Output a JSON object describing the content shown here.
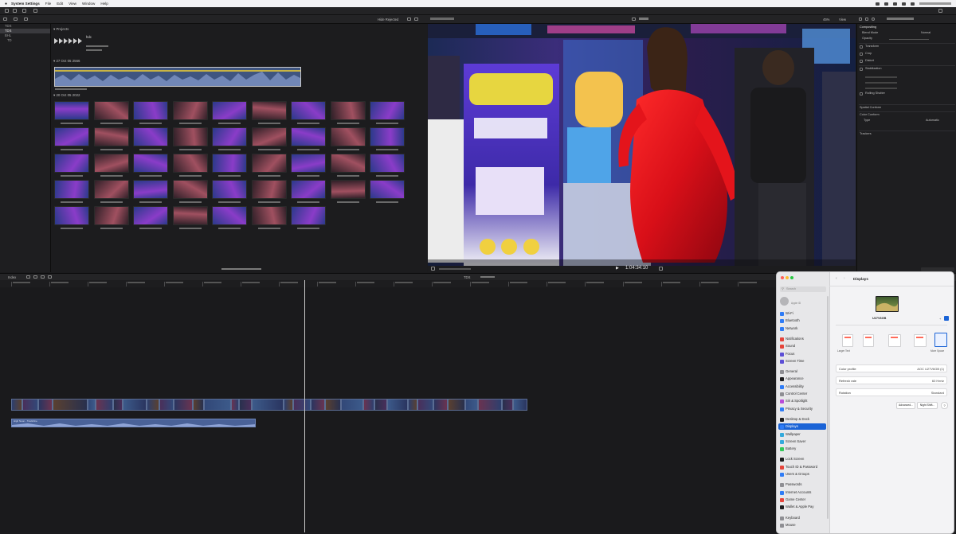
{
  "menubar": {
    "app": "System Settings",
    "items": [
      "File",
      "Edit",
      "View",
      "Window",
      "Help"
    ]
  },
  "toolbar": {
    "hide_rejected": "Hide Rejected",
    "zoom": "45%",
    "view": "View"
  },
  "libraries": {
    "items": [
      {
        "label": "TDS",
        "selected": false
      },
      {
        "label": "TDS",
        "selected": true
      },
      {
        "label": "BHL",
        "selected": false
      },
      {
        "label": "TD",
        "selected": false
      }
    ]
  },
  "browser": {
    "projects_header": "Projects",
    "project_name": "hdc",
    "section_27": "27 Oct 05 2566",
    "section_20": "20 Oct 05 2022",
    "footer": ""
  },
  "viewer": {
    "timecode": "1:04:34:10"
  },
  "inspector": {
    "sections": [
      "Compositing",
      "Transform",
      "Crop",
      "Distort",
      "Stabilization",
      "Rolling Shutter",
      "Spatial Conform",
      "Color Conform",
      "Trackers"
    ],
    "blend_mode_label": "Blend Mode",
    "blend_mode_value": "Normal",
    "opacity_label": "Opacity",
    "type_label": "Type",
    "type_value": "Automatic"
  },
  "timeline": {
    "index_label": "Index",
    "project_label": "TDS",
    "audio_label": "High Noon - TrackOne"
  },
  "settings": {
    "search_placeholder": "Search",
    "user_name": "",
    "user_sub": "Apple ID",
    "pane_title": "Displays",
    "display_name": "U27V6GB",
    "larger_text": "Larger Text",
    "more_space": "More Space",
    "rows": [
      {
        "label": "Color profile",
        "value": "AOC U27V6GB (1)"
      },
      {
        "label": "Refresh rate",
        "value": "60 Hertz"
      },
      {
        "label": "Rotation",
        "value": "Standard"
      }
    ],
    "advanced_label": "Advanced...",
    "night_shift_label": "Night Shift...",
    "help": "?",
    "sidebar": [
      {
        "label": "Wi-Fi",
        "color": "#2f7cf6",
        "selected": false
      },
      {
        "label": "Bluetooth",
        "color": "#2f7cf6",
        "selected": false
      },
      {
        "label": "Network",
        "color": "#2f7cf6",
        "selected": false
      },
      {
        "label": "Notifications",
        "color": "#e5453b",
        "selected": false
      },
      {
        "label": "Sound",
        "color": "#e5453b",
        "selected": false
      },
      {
        "label": "Focus",
        "color": "#5c4fd6",
        "selected": false
      },
      {
        "label": "Screen Time",
        "color": "#5c4fd6",
        "selected": false
      },
      {
        "label": "General",
        "color": "#8e8e93",
        "selected": false
      },
      {
        "label": "Appearance",
        "color": "#1c1c1e",
        "selected": false
      },
      {
        "label": "Accessibility",
        "color": "#2f7cf6",
        "selected": false
      },
      {
        "label": "Control Center",
        "color": "#8e8e93",
        "selected": false
      },
      {
        "label": "Siri & Spotlight",
        "color": "#b84bd8",
        "selected": false
      },
      {
        "label": "Privacy & Security",
        "color": "#2f7cf6",
        "selected": false
      },
      {
        "label": "Desktop & Dock",
        "color": "#1c1c1e",
        "selected": false
      },
      {
        "label": "Displays",
        "color": "#2f7cf6",
        "selected": true
      },
      {
        "label": "Wallpaper",
        "color": "#34aadc",
        "selected": false
      },
      {
        "label": "Screen Saver",
        "color": "#34aadc",
        "selected": false
      },
      {
        "label": "Battery",
        "color": "#34c759",
        "selected": false
      },
      {
        "label": "Lock Screen",
        "color": "#1c1c1e",
        "selected": false
      },
      {
        "label": "Touch ID & Password",
        "color": "#e5453b",
        "selected": false
      },
      {
        "label": "Users & Groups",
        "color": "#2f7cf6",
        "selected": false
      },
      {
        "label": "Passwords",
        "color": "#8e8e93",
        "selected": false
      },
      {
        "label": "Internet Accounts",
        "color": "#2f7cf6",
        "selected": false
      },
      {
        "label": "Game Center",
        "color": "#e5453b",
        "selected": false
      },
      {
        "label": "Wallet & Apple Pay",
        "color": "#1c1c1e",
        "selected": false
      },
      {
        "label": "Keyboard",
        "color": "#8e8e93",
        "selected": false
      },
      {
        "label": "Mouse",
        "color": "#8e8e93",
        "selected": false
      }
    ]
  }
}
